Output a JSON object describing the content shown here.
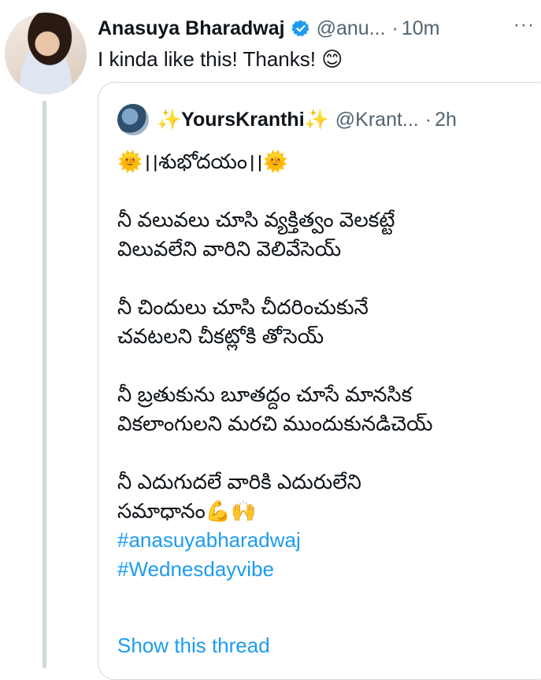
{
  "tweet": {
    "author_name": "Anasuya Bharadwaj",
    "author_handle": "@anu...",
    "separator": "·",
    "time": "10m",
    "more": "···",
    "text": "I kinda like this! Thanks!",
    "text_emoji": "😊"
  },
  "quoted_tweet": {
    "author_name_prefix": "✨",
    "author_name": "YoursKranthi",
    "author_name_suffix": "✨",
    "author_handle": "@Krant...",
    "separator": "·",
    "time": "2h",
    "lines": [
      "🌞।।శుభోదయం।।🌞",
      "",
      "నీ వలువలు చూసి వ్యక్తిత్వం వెలకట్టే",
      "విలువలేని వారిని వెలివేసెయ్",
      "",
      "నీ చిందులు చూసి చీదరించుకునే",
      "చవటలని చీకట్లోకి తోసెయ్",
      "",
      "నీ బ్రతుకును బూతద్దం చూసే మానసిక",
      "వికలాంగులని మరచి ముందుకునడిచెయ్",
      "",
      "నీ ఎదుగుదలే వారికి ఎదురులేని",
      "సమాధానం💪🙌"
    ],
    "hashtags": [
      "#anasuyabharadwaj",
      "#Wednesdayvibe"
    ],
    "show_thread": "Show this thread"
  },
  "colors": {
    "link_blue": "#1d9bf0",
    "secondary_text": "#536471",
    "border": "#cfd9de",
    "verified_blue": "#1d9bf0"
  },
  "icons": [
    "verified-badge-icon",
    "more-options-icon"
  ]
}
